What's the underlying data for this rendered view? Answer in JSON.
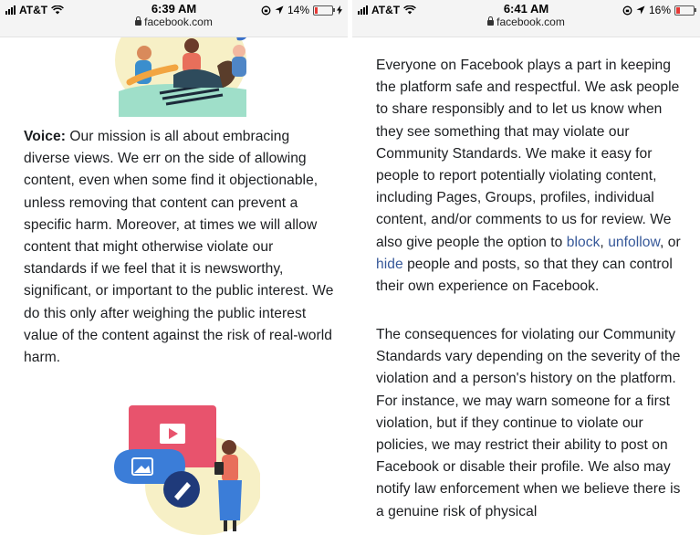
{
  "left_phone": {
    "status": {
      "carrier": "AT&T",
      "time": "6:39 AM",
      "url": "facebook.com",
      "battery": "14%",
      "battery_level": 0.14
    },
    "paragraph": {
      "heading": "Voice:",
      "text": " Our mission is all about embracing diverse views. We err on the side of allowing content, even when some find it objectionable, unless removing that content can prevent a specific harm. Moreover, at times we will allow content that might otherwise violate our standards if we feel that it is newsworthy, significant, or important to the public interest. We do this only after weighing the public interest value of the content against the risk of real-world harm."
    }
  },
  "right_phone": {
    "status": {
      "carrier": "AT&T",
      "time": "6:41 AM",
      "url": "facebook.com",
      "battery": "16%",
      "battery_level": 0.16
    },
    "paragraph1": {
      "text_a": "Everyone on Facebook plays a part in keeping the platform safe and respectful. We ask people to share responsibly and to let us know when they see something that may violate our Community Standards. We make it easy for people to report potentially violating content, including Pages, Groups, profiles, individual content, and/or comments to us for review. We also give people the option to ",
      "link_block": "block",
      "sep1": ", ",
      "link_unfollow": "unfollow",
      "sep2": ", or ",
      "link_hide": "hide",
      "text_b": " people and posts, so that they can control their own experience on Facebook."
    },
    "paragraph2": {
      "text": "The consequences for violating our Community Standards vary depending on the severity of the violation and a person's history on the platform. For instance, we may warn someone for a first violation, but if they continue to violate our policies, we may restrict their ability to post on Facebook or disable their profile. We also may notify law enforcement when we believe there is a genuine risk of physical"
    }
  },
  "colors": {
    "link": "#365899",
    "text": "#1c1e21",
    "battery_low": "#e53935"
  }
}
